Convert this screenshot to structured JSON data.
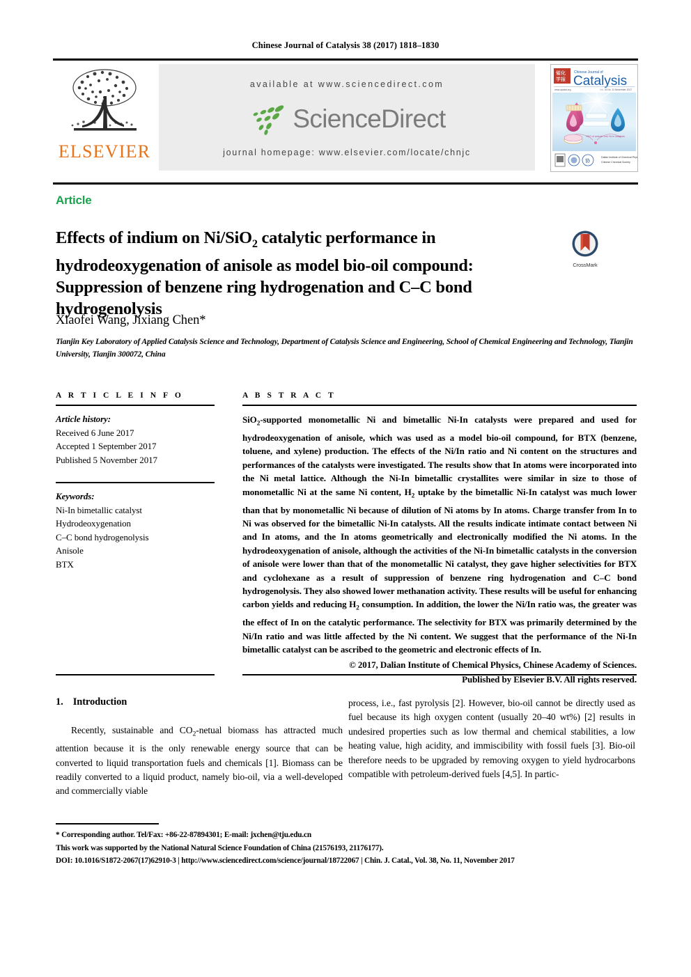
{
  "running_head": "Chinese Journal of Catalysis 38 (2017) 1818–1830",
  "masthead": {
    "publisher_name": "ELSEVIER",
    "available_at": "available at www.sciencedirect.com",
    "sciencedirect_logo_text": "ScienceDirect",
    "journal_homepage": "journal homepage: www.elsevier.com/locate/chnjc",
    "cover_title": "Catalysis",
    "cover_title_small": "Chinese Journal of"
  },
  "article_type": "Article",
  "title": {
    "line1_a": "Effects of indium on Ni/SiO",
    "line1_sub": "2",
    "line1_b": " catalytic performance in",
    "line2": "hydrodeoxygenation of anisole as model bio-oil compound:",
    "line3": "Suppression of benzene ring hydrogenation and C–C bond",
    "line4": "hydrogenolysis"
  },
  "crossmark_label": "CrossMark",
  "authors": "Xiaofei Wang, Jixiang Chen*",
  "affiliation": "Tianjin Key Laboratory of Applied Catalysis Science and Technology, Department of Catalysis Science and Engineering, School of Chemical Engineering and Technology, Tianjin University, Tianjin 300072, China",
  "article_info": {
    "heading": "A R T I C L E   I N F O",
    "history_label": "Article history:",
    "history": [
      "Received 6 June 2017",
      "Accepted 1 September 2017",
      "Published 5 November 2017"
    ],
    "keywords_label": "Keywords:",
    "keywords": [
      "Ni-In bimetallic catalyst",
      "Hydrodeoxygenation",
      "C–C bond hydrogenolysis",
      "Anisole",
      "BTX"
    ]
  },
  "abstract": {
    "heading": "A B S T R A C T",
    "p1_a": "SiO",
    "p1_sub1": "2",
    "p1_b": "-supported monometallic Ni and bimetallic Ni-In catalysts were prepared and used for hydrodeoxygenation of anisole, which was used as a model bio-oil compound, for BTX (benzene, toluene, and xylene) production. The effects of the Ni/In ratio and Ni content on the structures and performances of the catalysts were investigated. The results show that In atoms were incorporated into the Ni metal lattice. Although the Ni-In bimetallic crystallites were similar in size to those of monometallic Ni at the same Ni content, H",
    "p1_sub2": "2",
    "p1_c": " uptake by the bimetallic Ni-In catalyst was much lower than that by monometallic Ni because of dilution of Ni atoms by In atoms. Charge transfer from In to Ni was observed for the bimetallic Ni-In catalysts. All the results indicate intimate contact between Ni and In atoms, and the In atoms geometrically and electronically modified the Ni atoms. In the hydrodeoxygenation of anisole, although the activities of the Ni-In bimetallic catalysts in the conversion of anisole were lower than that of the monometallic Ni catalyst, they gave higher selectivities for BTX and cyclohexane as a result of suppression of benzene ring hydrogenation and C–C bond hydrogenolysis. They also showed lower methanation activity. These results will be useful for enhancing carbon yields and reducing H",
    "p1_sub3": "2",
    "p1_d": " consumption. In addition, the lower the Ni/In ratio was, the greater was the effect of In on the catalytic performance. The selectivity for BTX was primarily determined by the Ni/In ratio and was little affected by the Ni content. We suggest that the performance of the Ni-In bimetallic catalyst can be ascribed to the geometric and electronic effects of In.",
    "copyright_line1": "© 2017, Dalian Institute of Chemical Physics, Chinese Academy of Sciences.",
    "copyright_line2": "Published by Elsevier B.V. All rights reserved."
  },
  "body": {
    "section_number": "1.",
    "section_title": "Introduction",
    "left_paragraph_a": "Recently, sustainable and CO",
    "left_paragraph_sub": "2",
    "left_paragraph_b": "-netual biomass has attracted much attention because it is the only renewable energy source that can be converted to liquid transportation fuels and chemicals [1]. Biomass can be readily converted to a liquid product, namely bio-oil, via a well-developed and commercially viable",
    "right_paragraph": "process, i.e., fast pyrolysis [2]. However, bio-oil cannot be directly used as fuel because its high oxygen content (usually 20–40 wt%) [2] results in undesired properties such as low thermal and chemical stabilities, a low heating value, high acidity, and immiscibility with fossil fuels [3]. Bio-oil therefore needs to be upgraded by removing oxygen to yield hydrocarbons compatible with petroleum-derived fuels [4,5]. In partic-"
  },
  "footnotes": {
    "corresponding": "* Corresponding author. Tel/Fax: +86-22-87894301; E-mail: jxchen@tju.edu.cn",
    "funding": "This work was supported by the National Natural Science Foundation of China (21576193, 21176177).",
    "doi_line": "DOI: 10.1016/S1872-2067(17)62910-3 | http://www.sciencedirect.com/science/journal/18722067 | Chin. J. Catal., Vol. 38, No. 11, November 2017"
  },
  "colors": {
    "elsevier_orange": "#E8731B",
    "article_green": "#17a44c",
    "sciencedirect_grey": "#7b7b7b",
    "sciencedirect_leaf_green": "#5aa746",
    "masthead_bg": "#ececec"
  }
}
